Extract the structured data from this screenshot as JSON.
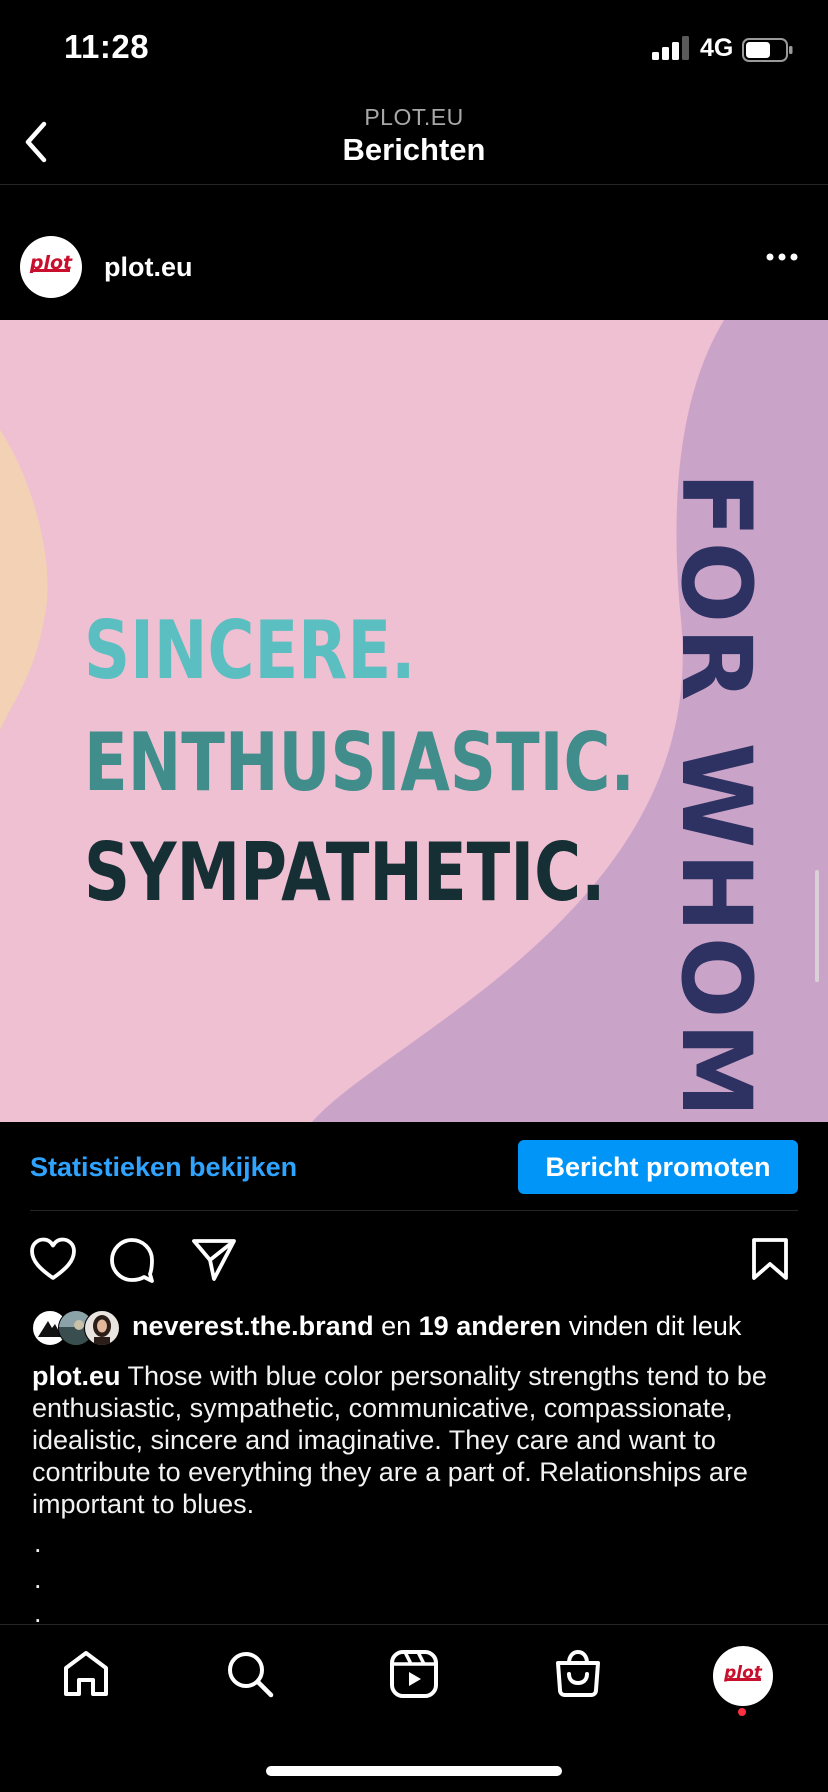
{
  "status_bar": {
    "time": "11:28",
    "network": "4G"
  },
  "header": {
    "account": "PLOT.EU",
    "title": "Berichten"
  },
  "post": {
    "username": "plot.eu",
    "avatar_text": "plot",
    "image_words": [
      "SINCERE.",
      "ENTHUSIASTIC.",
      "SYMPATHETIC."
    ],
    "image_side_text": "FOR WHOM?",
    "stats_label": "Statistieken bekijken",
    "promote_label": "Bericht promoten",
    "likes": {
      "user": "neverest.the.brand",
      "connector": "en",
      "others": "19 anderen",
      "suffix": "vinden dit leuk"
    },
    "caption_user": "plot.eu",
    "caption_text": "Those with blue color personality strengths tend to be enthusiastic, sympathetic, communicative, compassionate, idealistic, sincere and imaginative. They care and want to contribute to everything they are a part of. Relationships are important to blues.",
    "dots": [
      ".",
      ".",
      "."
    ]
  },
  "colors": {
    "accent_blue": "#0095f6",
    "link_blue": "#2ea3ff",
    "brand_red": "#c8102e",
    "image_bg": "#efbfd2",
    "image_purple": "#caa3c8"
  },
  "tabs": [
    "home-icon",
    "search-icon",
    "reels-icon",
    "shop-icon",
    "profile-avatar"
  ]
}
